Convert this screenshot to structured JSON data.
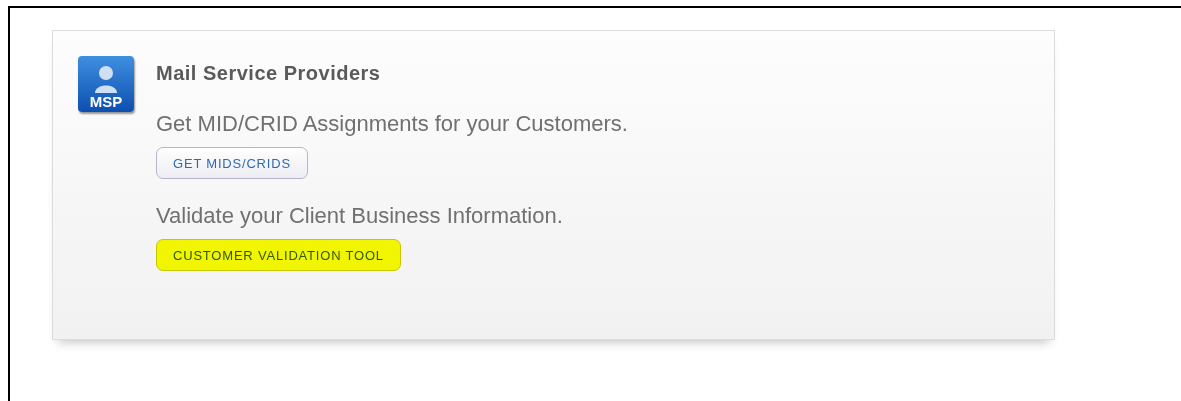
{
  "panel": {
    "icon_label": "MSP",
    "title": "Mail Service Providers",
    "sections": [
      {
        "text": "Get MID/CRID Assignments for your Customers.",
        "button": "GET MIDS/CRIDS",
        "highlighted": false
      },
      {
        "text": "Validate your Client Business Information.",
        "button": "CUSTOMER VALIDATION TOOL",
        "highlighted": true
      }
    ]
  }
}
